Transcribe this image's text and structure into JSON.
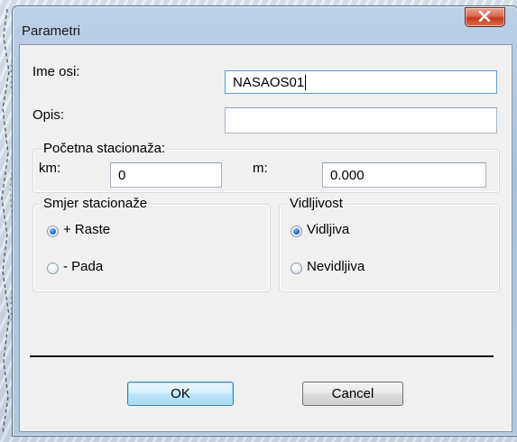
{
  "window": {
    "title": "Parametri",
    "close_glyph": "✕"
  },
  "fields": {
    "ime_osi": {
      "label": "Ime osi:",
      "value": "NASAOS01"
    },
    "opis": {
      "label": "Opis:",
      "value": ""
    }
  },
  "pocetna": {
    "legend": "Početna stacionaža:",
    "km_label": "km:",
    "km_value": "0",
    "m_label": "m:",
    "m_value": "0.000"
  },
  "smjer": {
    "legend": "Smjer stacionaže",
    "options": [
      {
        "label": "+ Raste",
        "checked": true
      },
      {
        "label": "- Pada",
        "checked": false
      }
    ]
  },
  "vidljivost": {
    "legend": "Vidljivost",
    "options": [
      {
        "label": "Vidljiva",
        "checked": true
      },
      {
        "label": "Nevidljiva",
        "checked": false
      }
    ]
  },
  "buttons": {
    "ok": "OK",
    "cancel": "Cancel"
  },
  "colors": {
    "default_button_border": "#3c7fb1",
    "close_button": "#c2391d",
    "radio_dot": "#1d6fc5"
  }
}
